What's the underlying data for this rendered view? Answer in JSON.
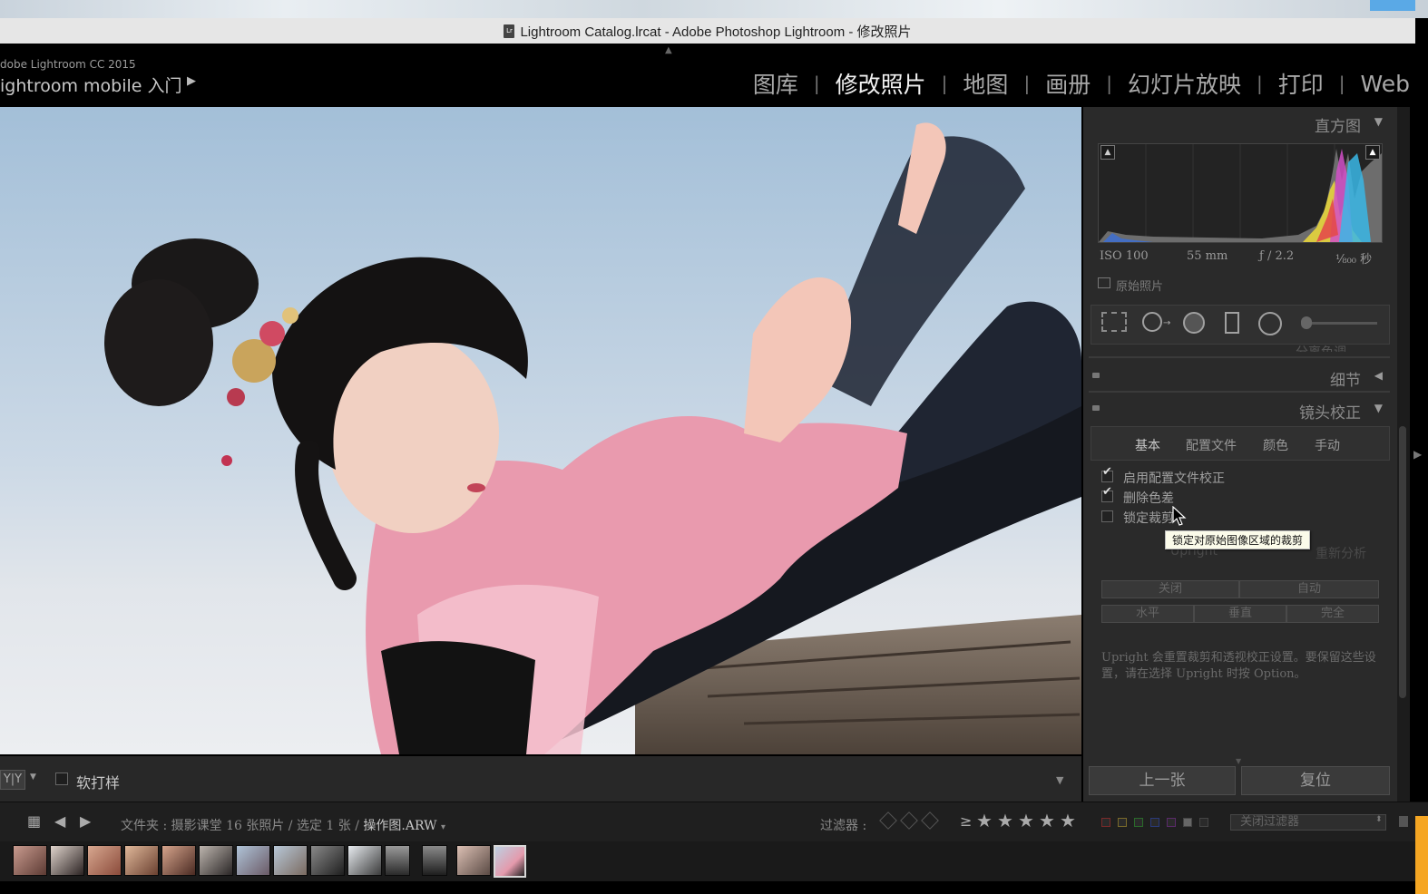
{
  "window": {
    "title": "Lightroom Catalog.lrcat - Adobe Photoshop Lightroom - 修改照片",
    "doc_icon_text": "Lr"
  },
  "identity": {
    "sub": "dobe Lightroom CC 2015",
    "main": "ightroom mobile 入门",
    "arrow": "▶"
  },
  "modules": [
    {
      "label": "图库",
      "active": false
    },
    {
      "label": "修改照片",
      "active": true
    },
    {
      "label": "地图",
      "active": false
    },
    {
      "label": "画册",
      "active": false
    },
    {
      "label": "幻灯片放映",
      "active": false
    },
    {
      "label": "打印",
      "active": false
    },
    {
      "label": "Web",
      "active": false
    }
  ],
  "module_separator": "|",
  "histogram": {
    "title": "直方图",
    "exif": {
      "iso": "ISO 100",
      "focal": "55 mm",
      "aperture": "ƒ / 2.2",
      "shutter": "¹⁄₈₀₀ 秒"
    },
    "original_photo_label": "原始照片"
  },
  "panels": {
    "hidden_partial": "分离色调",
    "detail_title": "细节",
    "lens_title": "镜头校正"
  },
  "lens": {
    "tabs": [
      "基本",
      "配置文件",
      "颜色",
      "手动"
    ],
    "checks": [
      {
        "label": "启用配置文件校正",
        "checked": true
      },
      {
        "label": "删除色差",
        "checked": true
      },
      {
        "label": "锁定裁剪",
        "checked": false
      }
    ],
    "tooltip": "锁定对原始图像区域的裁剪",
    "hidden_row_left": "Upright",
    "hidden_row_right": "重新分析",
    "upright_row1": [
      "关闭",
      "自动"
    ],
    "upright_row2": [
      "水平",
      "垂直",
      "完全"
    ],
    "upright_note": "Upright 会重置裁剪和透视校正设置。要保留这些设置，请在选择 Upright 时按 Option。"
  },
  "buttons": {
    "previous": "上一张",
    "reset": "复位"
  },
  "toolbar": {
    "yy_label": "Y|Y",
    "soft_proof": "软打样"
  },
  "filmstrip_bar": {
    "breadcrumb_prefix": "文件夹 : 摄影课堂   16 张照片 / 选定 1 张 /",
    "current_file": "操作图.ARW",
    "file_drop": "▾",
    "filter_label": "过滤器 :",
    "gte": "≥",
    "stars": [
      "★",
      "★",
      "★",
      "★",
      "★"
    ],
    "close_filter": "关闭过滤器"
  },
  "filmstrip": {
    "thumb_count": 14,
    "selected_index": 13
  },
  "colors": {
    "accent": "#f5a623",
    "panel_bg": "#2a2a2a",
    "active_module": "#f2f2f2"
  }
}
